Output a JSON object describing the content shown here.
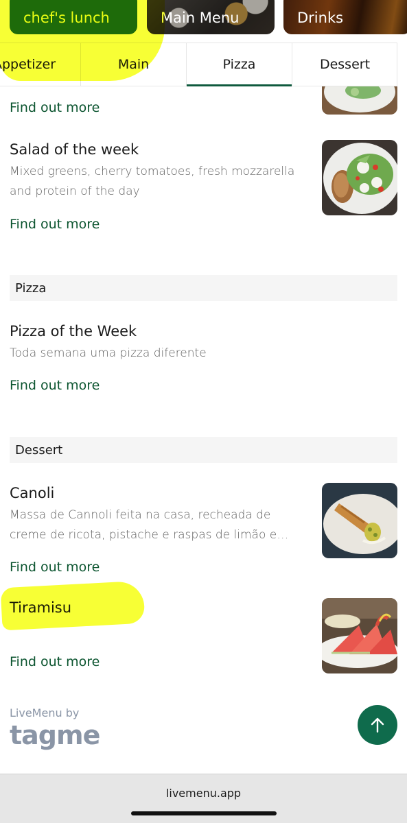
{
  "menus": [
    {
      "label": "chef's lunch"
    },
    {
      "label": "Main Menu"
    },
    {
      "label": "Drinks"
    }
  ],
  "tabs": [
    {
      "label": "Appetizer"
    },
    {
      "label": "Main"
    },
    {
      "label": "Pizza"
    },
    {
      "label": "Dessert"
    }
  ],
  "active_tab": "Pizza",
  "find_more_label": "Find out more",
  "items": {
    "salad": {
      "title": "Salad of the week",
      "desc": "Mixed greens, cherry tomatoes, fresh mozzarella and protein of the day"
    },
    "pizza": {
      "title": "Pizza of the Week",
      "desc": "Toda semana uma pizza diferente"
    },
    "canoli": {
      "title": "Canoli",
      "desc": "Massa de Cannoli feita na casa, recheada de creme de ricota, pistache e raspas de limão e…"
    },
    "tiramisu": {
      "title": "Tiramisu"
    }
  },
  "sections": {
    "pizza": "Pizza",
    "dessert": "Dessert"
  },
  "footer": {
    "by": "LiveMenu by",
    "logo": "tagme"
  },
  "browser": {
    "url": "livemenu.app"
  },
  "colors": {
    "brand_green": "#0f6b4c",
    "link_green": "#0c5530",
    "highlight": "#f6ff12"
  }
}
